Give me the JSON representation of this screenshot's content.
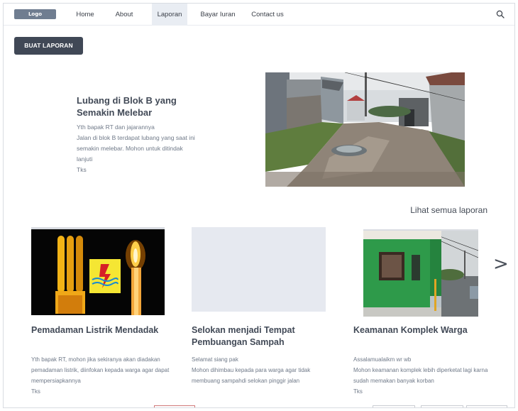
{
  "nav": {
    "logo": "Logo",
    "items": [
      "Home",
      "About",
      "Laporan",
      "Bayar Iuran",
      "Contact us"
    ],
    "active": "Laporan"
  },
  "actions": {
    "create_report": "BUAT LAPORAN"
  },
  "featured": {
    "title": "Lubang di Blok B yang Semakin Melebar",
    "body": [
      "Yth bapak RT dan jajarannya",
      "Jalan di blok B terdapat lubang yang saat ini semakin melebar. Mohon untuk ditindak lanjuti",
      "Tks"
    ]
  },
  "see_all": "Lihat semua laporan",
  "cards": [
    {
      "title": "Pemadaman Listrik Mendadak",
      "body": [
        "Yth bapak RT, mohon jika sekiranya akan diadakan pemadaman listrik, diinfokan kepada warga agar dapat mempersiapkannya",
        "Tks"
      ]
    },
    {
      "title": "Selokan menjadi Tempat Pembuangan Sampah",
      "body": [
        "Selamat siang pak",
        "Mohon dihimbau kepada para warga agar tidak membuang sampahdi selokan pinggir jalan"
      ]
    },
    {
      "title": "Keamanan Komplek Warga",
      "body": [
        "Assalamualaikm wr wb",
        "Mohon keamanan komplek lebih diperketat lagi karna  sudah memakan banyak korban",
        "Tks"
      ]
    }
  ],
  "next": ">",
  "colors": {
    "primary_button": "#404856",
    "logo_bg": "#6f7d90",
    "placeholder": "#e6e9f0"
  },
  "icons": {
    "search": "search-icon",
    "next": "chevron-right-icon"
  }
}
